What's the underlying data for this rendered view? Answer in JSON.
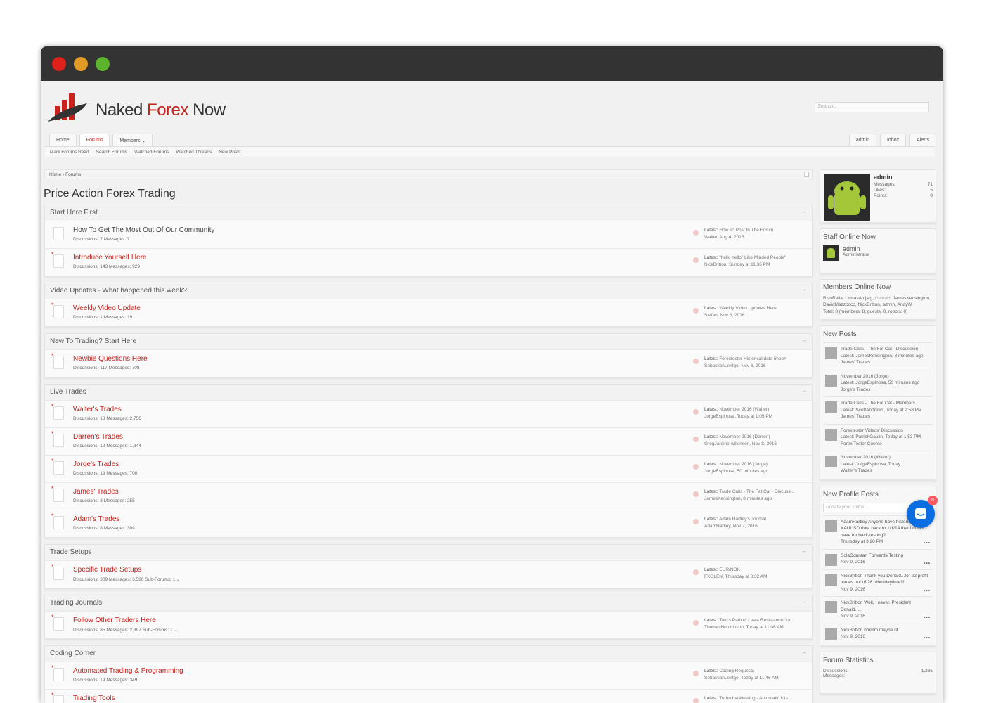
{
  "window": {
    "dots": [
      "#e0201b",
      "#e09a26",
      "#5db32b"
    ]
  },
  "site": {
    "logo_word1": "Naked",
    "logo_word2": "Forex",
    "logo_word3": "Now",
    "search_placeholder": "Search..."
  },
  "nav": {
    "tabs": [
      "Home",
      "Forums",
      "Members"
    ],
    "right": [
      "admin",
      "Inbox",
      "Alerts"
    ],
    "sub": [
      "Mark Forums Read",
      "Search Forums",
      "Watched Forums",
      "Watched Threads",
      "New Posts"
    ]
  },
  "breadcrumb": [
    "Home",
    "Forums"
  ],
  "page_title": "Price Action Forex Trading",
  "categories": [
    {
      "title": "Start Here First",
      "nodes": [
        {
          "title": "How To Get The Most Out Of Our Community",
          "new": false,
          "stats": "Discussions: 7  Messages: 7",
          "latest": "How To Post In The Forum",
          "by": "Walter, Aug 4, 2015"
        },
        {
          "title": "Introduce Yourself Here",
          "new": true,
          "stats": "Discussions: 143  Messages: 929",
          "latest": "\"hello hello\" Like Minded People\"",
          "by": "NickBritton, Sunday at 11:36 PM"
        }
      ]
    },
    {
      "title": "Video Updates - What happened this week?",
      "nodes": [
        {
          "title": "Weekly Video Update",
          "new": true,
          "stats": "Discussions: 1  Messages: 19",
          "latest": "Weekly Video Updates Here",
          "by": "Stefan, Nov 6, 2016"
        }
      ]
    },
    {
      "title": "New To Trading? Start Here",
      "nodes": [
        {
          "title": "Newbie Questions Here",
          "new": true,
          "stats": "Discussions: 117  Messages: 708",
          "latest": "Forextester Historical data import",
          "by": "SebastianLentge, Nov 6, 2016"
        }
      ]
    },
    {
      "title": "Live Trades",
      "nodes": [
        {
          "title": "Walter's Trades",
          "new": true,
          "stats": "Discussions: 18  Messages: 2,756",
          "latest": "November 2016 (Walter)",
          "by": "JorgeEspinosa, Today at 1:05 PM"
        },
        {
          "title": "Darren's Trades",
          "new": true,
          "stats": "Discussions: 19  Messages: 1,344",
          "latest": "November 2016 (Darren)",
          "by": "GregJardine-wilkinson, Nov 8, 2016"
        },
        {
          "title": "Jorge's Trades",
          "new": true,
          "stats": "Discussions: 19  Messages: 700",
          "latest": "November 2016 (Jorge)",
          "by": "JorgeEspinosa, 50 minutes ago"
        },
        {
          "title": "James' Trades",
          "new": true,
          "stats": "Discussions: 8  Messages: 255",
          "latest": "Trade Calls - The Fat Cat - Discuss...",
          "by": "JamesKensington, 8 minutes ago"
        },
        {
          "title": "Adam's Trades",
          "new": true,
          "stats": "Discussions: 8  Messages: 309",
          "latest": "Adam Hartley's Journal",
          "by": "AdamHartley, Nov 7, 2016"
        }
      ]
    },
    {
      "title": "Trade Setups",
      "nodes": [
        {
          "title": "Specific Trade Setups",
          "new": true,
          "stats": "Discussions: 309  Messages: 3,580   Sub-Forums: 1 ⌄",
          "latest": "EUR/NOK",
          "by": "FXGLEN, Thursday at 8:32 AM"
        }
      ]
    },
    {
      "title": "Trading Journals",
      "nodes": [
        {
          "title": "Follow Other Traders Here",
          "new": true,
          "stats": "Discussions: 85  Messages: 2,397   Sub-Forums: 1 ⌄",
          "latest": "Tom's Path of Least Resistance Jou...",
          "by": "ThomasHutchinson, Today at 11:08 AM"
        }
      ]
    },
    {
      "title": "Coding Corner",
      "nodes": [
        {
          "title": "Automated Trading & Programming",
          "new": true,
          "stats": "Discussions: 19  Messages: 349",
          "latest": "Coding Requests",
          "by": "SebastianLentge, Today at 11:46 AM"
        },
        {
          "title": "Trading Tools",
          "new": true,
          "stats": "",
          "latest": "Turbo backtesting - Automatic lots...",
          "by": ""
        }
      ]
    }
  ],
  "latest_prefix": "Latest:",
  "visitor": {
    "name": "admin",
    "rows": [
      [
        "Messages:",
        "71"
      ],
      [
        "Likes:",
        "5"
      ],
      [
        "Points:",
        "8"
      ]
    ]
  },
  "staff": {
    "title": "Staff Online Now",
    "name": "admin",
    "role": "Administrator"
  },
  "members": {
    "title": "Members Online Now",
    "list": "RivoRella, UrmasAnijalg,",
    "guest": "GlennH,",
    "list2": "JamesKensington, DavidMazzocco, NickBritton, admin, AndyW",
    "total": "Total: 8 (members: 8, guests: 0, robots: 0)"
  },
  "new_posts": {
    "title": "New Posts",
    "items": [
      {
        "t": "Trade Calls - The Fat Cat - Discussion",
        "l": "Latest: JamesKensington, 8 minutes ago",
        "f": "James' Trades"
      },
      {
        "t": "November 2016 (Jorge)",
        "l": "Latest: JorgeEspinosa, 50 minutes ago",
        "f": "Jorge's Trades"
      },
      {
        "t": "Trade Calls - The Fat Cat - Members",
        "l": "Latest: ScottAndrews, Today at 2:58 PM",
        "f": "James' Trades"
      },
      {
        "t": "Forextester Videos' Discussion",
        "l": "Latest: PatrickGaulin, Today at 1:53 PM",
        "f": "Forex Tester Course"
      },
      {
        "t": "November 2016 (Walter)",
        "l": "Latest: JorgeEspinosa, Today",
        "f": "Walter's Trades"
      }
    ]
  },
  "profile_posts": {
    "title": "New Profile Posts",
    "placeholder": "Update your status...",
    "items": [
      {
        "t": "AdamHartley Anyone have historic 1minute XAUUSD data back to 1/1/14 that I could have for back-testing?",
        "d": "Thursday at 3:28 PM"
      },
      {
        "t": "SolaOduntan Forwards Testing",
        "d": "Nov 9, 2016"
      },
      {
        "t": "NickBritton Thank you Donald...for 22 profit trades out of 26. #holidaytime!!!",
        "d": "Nov 9, 2016"
      },
      {
        "t": "NickBritton Well, I never. President Donald.....",
        "d": "Nov 9, 2016"
      },
      {
        "t": "NickBritton hmmm maybe nt....",
        "d": "Nov 9, 2016"
      }
    ]
  },
  "stats": {
    "title": "Forum Statistics",
    "rows": [
      [
        "Discussions:",
        "1,235"
      ],
      [
        "Messages:",
        ""
      ]
    ]
  },
  "chat": {
    "badge": "8"
  }
}
